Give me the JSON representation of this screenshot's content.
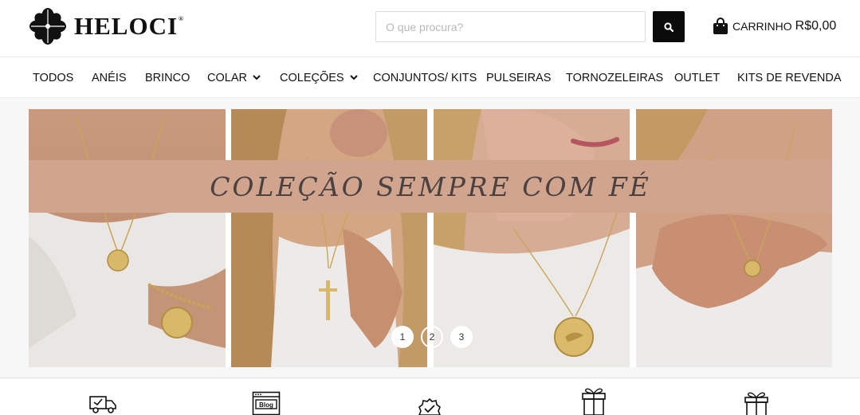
{
  "brand": {
    "name": "HELOCI",
    "reg_mark": "®"
  },
  "search": {
    "placeholder": "O que procura?"
  },
  "cart": {
    "label": "CARRINHO",
    "value": "R$0,00"
  },
  "nav": {
    "items": [
      {
        "label": "TODOS",
        "dropdown": false
      },
      {
        "label": "ANÉIS",
        "dropdown": false
      },
      {
        "label": "BRINCO",
        "dropdown": false
      },
      {
        "label": "COLAR",
        "dropdown": true
      },
      {
        "label": "COLEÇÕES",
        "dropdown": true
      },
      {
        "label": "CONJUNTOS/ KITS",
        "dropdown": false
      },
      {
        "label": "PULSEIRAS",
        "dropdown": false
      },
      {
        "label": "TORNOZELEIRAS",
        "dropdown": false
      },
      {
        "label": "OUTLET",
        "dropdown": false
      },
      {
        "label": "KITS DE REVENDA",
        "dropdown": false
      }
    ]
  },
  "banner": {
    "title": "COLEÇÃO SEMPRE COM FÉ",
    "band_color": "#d1a48e",
    "dots": [
      "1",
      "2",
      "3"
    ],
    "active_dot": "1"
  },
  "features": {
    "icons": [
      "delivery-truck-icon",
      "blog-icon",
      "verified-badge-icon",
      "gift-box-icon",
      "gift-icon"
    ],
    "blog_label": "Blog"
  },
  "colors": {
    "accent": "#0b0b0b",
    "band": "#d1a48e"
  }
}
